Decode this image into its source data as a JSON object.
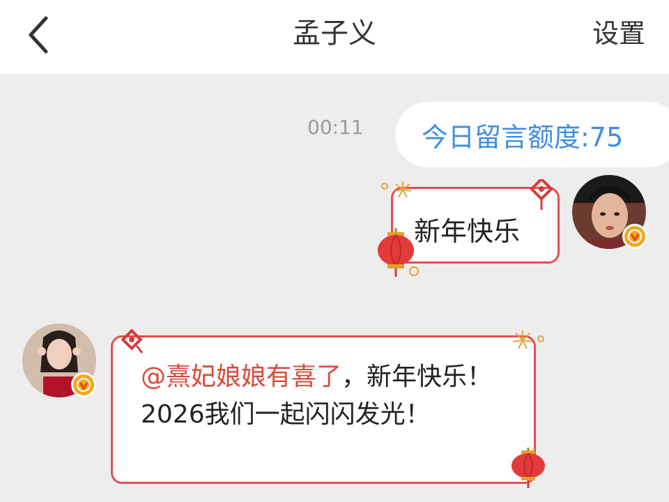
{
  "header": {
    "title": "孟子义",
    "settings_label": "设置"
  },
  "chat": {
    "timestamp": "00:11",
    "quota_message": "今日留言额度:75",
    "sent_message": "新年快乐",
    "received_message": {
      "mention": "@熹妃娘娘有喜了",
      "text": "，新年快乐！2026我们一起闪闪发光！"
    }
  },
  "colors": {
    "accent_blue": "#3d8ee0",
    "festive_red": "#e54d4d",
    "mention_red": "#d94a3a",
    "badge_gold": "#f5a623"
  },
  "icons": {
    "back": "chevron-left-icon",
    "verified": "verified-v-badge-icon"
  }
}
